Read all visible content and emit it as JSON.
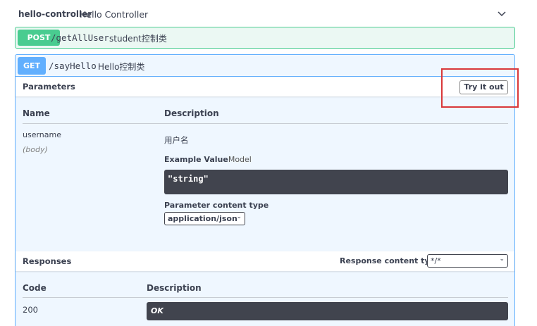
{
  "tag": {
    "name": "hello-controller",
    "description": "Hello Controller"
  },
  "post_op": {
    "method": "POST",
    "path": "/getAllUser",
    "summary": "student控制类"
  },
  "get_op": {
    "method": "GET",
    "path": "/sayHello",
    "summary": "Hello控制类",
    "parameters_title": "Parameters",
    "try_it_out_label": "Try it out",
    "param_headers": {
      "name": "Name",
      "description": "Description"
    },
    "param": {
      "name": "username",
      "in": "(body)",
      "description": "用户名",
      "example_label": "Example Value",
      "model_label": "Model",
      "example_value": "\"string\"",
      "content_type_label": "Parameter content type",
      "content_type_value": "application/json"
    },
    "responses_title": "Responses",
    "response_content_type_label": "Response content type",
    "response_content_type_value": "*/*",
    "response_headers": {
      "code": "Code",
      "description": "Description"
    },
    "response": {
      "code": "200",
      "description": "OK"
    }
  },
  "colors": {
    "post": "#49cc90",
    "get": "#61affe",
    "highlight": "#d9383a",
    "code_bg": "#41444e"
  }
}
